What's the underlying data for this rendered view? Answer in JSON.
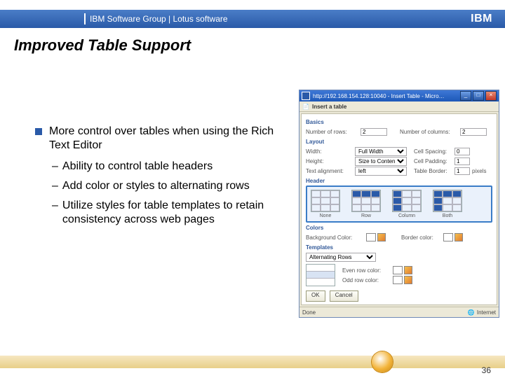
{
  "header": {
    "title": "IBM Software Group | Lotus software",
    "brand": "IBM"
  },
  "slide": {
    "title": "Improved Table Support",
    "bullet1": "More control over tables when using the Rich Text Editor",
    "sub1": "Ability to control table headers",
    "sub2": "Add color or styles to alternating rows",
    "sub3": "Utilize styles for table templates to retain consistency across web pages",
    "dash": "–",
    "page": "36"
  },
  "dlg": {
    "url": "http://192.168.154.128:10040 - Insert Table - Micro…",
    "win": {
      "min": "_",
      "max": "□",
      "close": "×"
    },
    "chrome": {
      "icon": "📄",
      "title": "Insert a table"
    },
    "sect": {
      "basics": "Basics",
      "layout": "Layout",
      "header": "Header",
      "colors": "Colors",
      "templates": "Templates"
    },
    "basics": {
      "rows_lab": "Number of rows:",
      "rows_val": "2",
      "cols_lab": "Number of columns:",
      "cols_val": "2"
    },
    "layout": {
      "width_lab": "Width:",
      "width_val": "Full Width",
      "spacing_lab": "Cell Spacing:",
      "spacing_val": "0",
      "height_lab": "Height:",
      "height_val": "Size to Content",
      "padding_lab": "Cell Padding:",
      "padding_val": "1",
      "align_lab": "Text alignment:",
      "align_val": "left",
      "border_lab": "Table Border:",
      "border_val": "1",
      "border_unit": "pixels"
    },
    "tiles": {
      "t0": "None",
      "t1": "Row",
      "t2": "Column",
      "t3": "Both"
    },
    "colors": {
      "bg_lab": "Background Color:",
      "bd_lab": "Border color:"
    },
    "templates": {
      "style_val": "Alternating Rows",
      "even_lab": "Even row color:",
      "odd_lab": "Odd row color:"
    },
    "btn": {
      "ok": "OK",
      "cancel": "Cancel"
    },
    "status": {
      "done": "Done",
      "zone": "Internet"
    }
  }
}
